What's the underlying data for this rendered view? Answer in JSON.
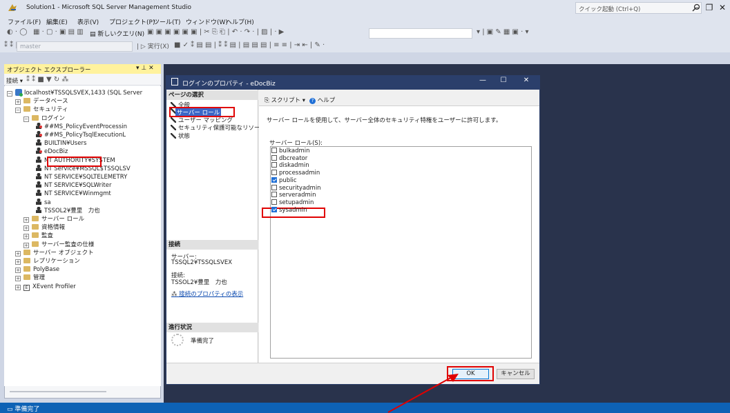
{
  "app": {
    "title": "Solution1 - Microsoft SQL Server Management Studio",
    "quick_launch_placeholder": "クイック起動 (Ctrl+Q)"
  },
  "menu": [
    "ファイル(F)",
    "編集(E)",
    "表示(V)",
    "プロジェクト(P)",
    "ツール(T)",
    "ウィンドウ(W)",
    "ヘルプ(H)"
  ],
  "toolbar": {
    "new_query": "新しいクエリ(N)",
    "execute": "実行(X)",
    "database": "master"
  },
  "object_explorer": {
    "title": "オブジェクト エクスプローラー",
    "connect": "接続",
    "tree": [
      {
        "label": "localhost¥TSSQLSVEX,1433 (SQL Server",
        "level": 0,
        "icon": "server",
        "exp": "-"
      },
      {
        "label": "データベース",
        "level": 1,
        "icon": "folder",
        "exp": "+"
      },
      {
        "label": "セキュリティ",
        "level": 1,
        "icon": "folder",
        "exp": "-"
      },
      {
        "label": "ログイン",
        "level": 2,
        "icon": "folder",
        "exp": "-"
      },
      {
        "label": "##MS_PolicyEventProcessin",
        "level": 3,
        "icon": "user-x"
      },
      {
        "label": "##MS_PolicyTsqlExecutionL",
        "level": 3,
        "icon": "user-x"
      },
      {
        "label": "BUILTIN¥Users",
        "level": 3,
        "icon": "group"
      },
      {
        "label": "eDocBiz",
        "level": 3,
        "icon": "user-x"
      },
      {
        "label": "NT AUTHORITY¥SYSTEM",
        "level": 3,
        "icon": "user"
      },
      {
        "label": "NT Service¥MSSQL$TSSQLSV",
        "level": 3,
        "icon": "user"
      },
      {
        "label": "NT SERVICE¥SQLTELEMETRY",
        "level": 3,
        "icon": "user"
      },
      {
        "label": "NT SERVICE¥SQLWriter",
        "level": 3,
        "icon": "user"
      },
      {
        "label": "NT SERVICE¥Winmgmt",
        "level": 3,
        "icon": "user"
      },
      {
        "label": "sa",
        "level": 3,
        "icon": "user"
      },
      {
        "label": "TSSOL2¥豊里　力也",
        "level": 3,
        "icon": "user"
      },
      {
        "label": "サーバー ロール",
        "level": 2,
        "icon": "folder",
        "exp": "+"
      },
      {
        "label": "資格情報",
        "level": 2,
        "icon": "folder",
        "exp": "+"
      },
      {
        "label": "監査",
        "level": 2,
        "icon": "folder",
        "exp": "+"
      },
      {
        "label": "サーバー監査の仕様",
        "level": 2,
        "icon": "folder",
        "exp": "+"
      },
      {
        "label": "サーバー オブジェクト",
        "level": 1,
        "icon": "folder",
        "exp": "+"
      },
      {
        "label": "レプリケーション",
        "level": 1,
        "icon": "folder",
        "exp": "+"
      },
      {
        "label": "PolyBase",
        "level": 1,
        "icon": "folder",
        "exp": "+"
      },
      {
        "label": "管理",
        "level": 1,
        "icon": "folder",
        "exp": "+"
      },
      {
        "label": "XEvent Profiler",
        "level": 1,
        "icon": "xevent",
        "exp": "+"
      }
    ]
  },
  "dialog": {
    "title": "ログインのプロパティ - eDocBiz",
    "page_select_header": "ページの選択",
    "pages": [
      "全般",
      "サーバー ロール",
      "ユーザー マッピング",
      "セキュリティ保護可能なリソース",
      "状態"
    ],
    "selected_page": "サーバー ロール",
    "script_label": "スクリプト",
    "help_label": "ヘルプ",
    "description": "サーバー ロールを使用して、サーバー全体のセキュリティ特権をユーザーに許可します。",
    "roles_label": "サーバー ロール(S):",
    "roles": [
      {
        "name": "bulkadmin",
        "checked": false
      },
      {
        "name": "dbcreator",
        "checked": false
      },
      {
        "name": "diskadmin",
        "checked": false
      },
      {
        "name": "processadmin",
        "checked": false
      },
      {
        "name": "public",
        "checked": true
      },
      {
        "name": "securityadmin",
        "checked": false
      },
      {
        "name": "serveradmin",
        "checked": false
      },
      {
        "name": "setupadmin",
        "checked": false
      },
      {
        "name": "sysadmin",
        "checked": true
      }
    ],
    "connection_header": "接続",
    "server_label": "サーバー:",
    "server_value": "TSSQL2¥TSSQLSVEX",
    "conn_label": "接続:",
    "conn_value": "TSSOL2¥豊里　力也",
    "conn_props_link": "接続のプロパティの表示",
    "progress_header": "進行状況",
    "progress_status": "準備完了",
    "ok_label": "OK",
    "cancel_label": "キャンセル"
  },
  "status": {
    "text": "準備完了"
  },
  "colors": {
    "highlight": "#e00000",
    "statusbar": "#0e62b5",
    "dialog_title": "#2b3f6b"
  }
}
